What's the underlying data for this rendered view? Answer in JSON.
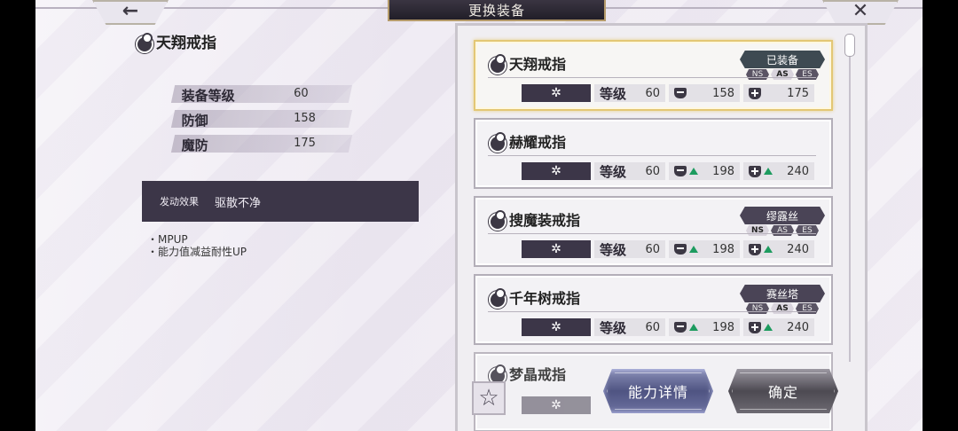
{
  "header": {
    "title": "更换装备",
    "back_glyph": "←",
    "close_glyph": "✕"
  },
  "detail": {
    "name": "天翔戒指",
    "stats": [
      {
        "label": "装备等级",
        "value": "60"
      },
      {
        "label": "防御",
        "value": "158"
      },
      {
        "label": "魔防",
        "value": "175"
      }
    ],
    "effect_label": "发动效果",
    "effect_value": "驱散不净",
    "effect_lines": [
      "・MPUP",
      "・能力值减益耐性UP"
    ]
  },
  "list": {
    "gear_glyph": "✲",
    "level_label": "等级",
    "items": [
      {
        "name": "天翔戒指",
        "level": "60",
        "def": "158",
        "mdef": "175",
        "owner": "已装备",
        "tags": [
          "NS",
          "AS",
          "ES"
        ],
        "active_tag": "AS",
        "def_up": false,
        "mdef_up": false
      },
      {
        "name": "赫耀戒指",
        "level": "60",
        "def": "198",
        "mdef": "240",
        "owner": "",
        "tags": [],
        "active_tag": "",
        "def_up": true,
        "mdef_up": true
      },
      {
        "name": "搜魔装戒指",
        "level": "60",
        "def": "198",
        "mdef": "240",
        "owner": "缪露丝",
        "tags": [
          "NS",
          "AS",
          "ES"
        ],
        "active_tag": "NS",
        "def_up": true,
        "mdef_up": true
      },
      {
        "name": "千年树戒指",
        "level": "60",
        "def": "198",
        "mdef": "240",
        "owner": "赛丝塔",
        "tags": [
          "NS",
          "AS",
          "ES"
        ],
        "active_tag": "AS",
        "def_up": true,
        "mdef_up": true
      },
      {
        "name": "梦晶戒指",
        "partial": true
      }
    ]
  },
  "footer": {
    "favorite_glyph": "☆",
    "detail_button": "能力详情",
    "confirm_button": "确定"
  },
  "colors": {
    "panel_dark": "#3c3648",
    "up_arrow": "#1d9b5f",
    "selected_border": "#e3c775"
  }
}
